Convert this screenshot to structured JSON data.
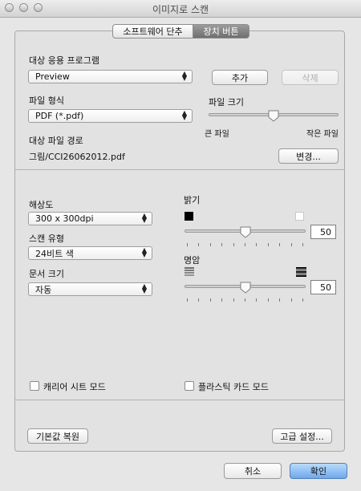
{
  "window": {
    "title": "이미지로 스캔"
  },
  "tabs": [
    {
      "label": "소프트웨어 단추",
      "selected": false
    },
    {
      "label": "장치 버튼",
      "selected": true
    }
  ],
  "app": {
    "label": "대상 응용 프로그램",
    "value": "Preview",
    "add_label": "추가",
    "delete_label": "삭제"
  },
  "file_type": {
    "label": "파일 형식",
    "value": "PDF (*.pdf)"
  },
  "file_size": {
    "label": "파일 크기",
    "min_label": "큰 파일",
    "max_label": "작은 파일",
    "level": 0.5
  },
  "dest": {
    "label": "대상 파일 경로",
    "path": "그림/CCI26062012.pdf",
    "change_label": "변경..."
  },
  "resolution": {
    "label": "해상도",
    "value": "300 x 300dpi"
  },
  "scan_type": {
    "label": "스캔 유형",
    "value": "24비트 색"
  },
  "doc_size": {
    "label": "문서 크기",
    "value": "자동"
  },
  "brightness": {
    "label": "밝기",
    "value": "50",
    "level": 0.5
  },
  "contrast": {
    "label": "명암",
    "value": "50",
    "level": 0.5
  },
  "options": {
    "carrier_label": "캐리어 시트 모드",
    "plastic_label": "플라스틱 카드 모드"
  },
  "buttons": {
    "reset": "기본값 복원",
    "advanced": "고급 설정...",
    "cancel": "취소",
    "ok": "확인"
  },
  "colors": {
    "primary": "#6fa9ec",
    "tab_selected": "#7f7f7f"
  }
}
